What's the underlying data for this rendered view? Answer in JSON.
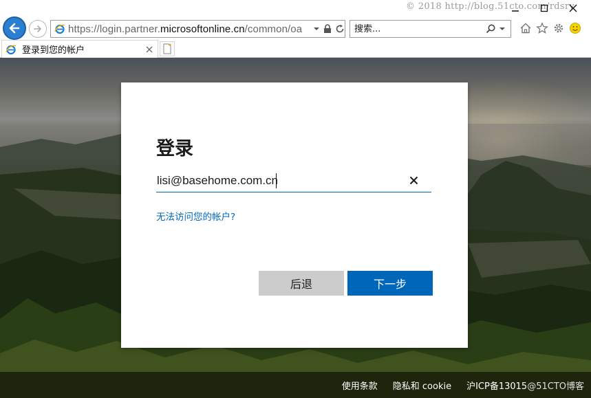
{
  "browser": {
    "address": {
      "scheme": "https://",
      "prefix": "login.partner.",
      "host": "microsoftonline.cn",
      "path": "/common/oa"
    },
    "search": {
      "placeholder": "搜索..."
    },
    "tab": {
      "title": "登录到您的帐户"
    },
    "watermark": "© 2018 http://blog.51cto.com/rdsrv"
  },
  "signin": {
    "title": "登录",
    "email_value": "lisi@basehome.com.cn",
    "cant_access_link": "无法访问您的帐户?",
    "back_button": "后退",
    "next_button": "下一步"
  },
  "footer": {
    "terms": "使用条款",
    "privacy": "隐私和 cookie",
    "icp": "沪ICP备13015",
    "watermark": "@51CTO博客"
  },
  "colors": {
    "accent": "#0067b8",
    "back_button_bg": "#cccccc"
  }
}
